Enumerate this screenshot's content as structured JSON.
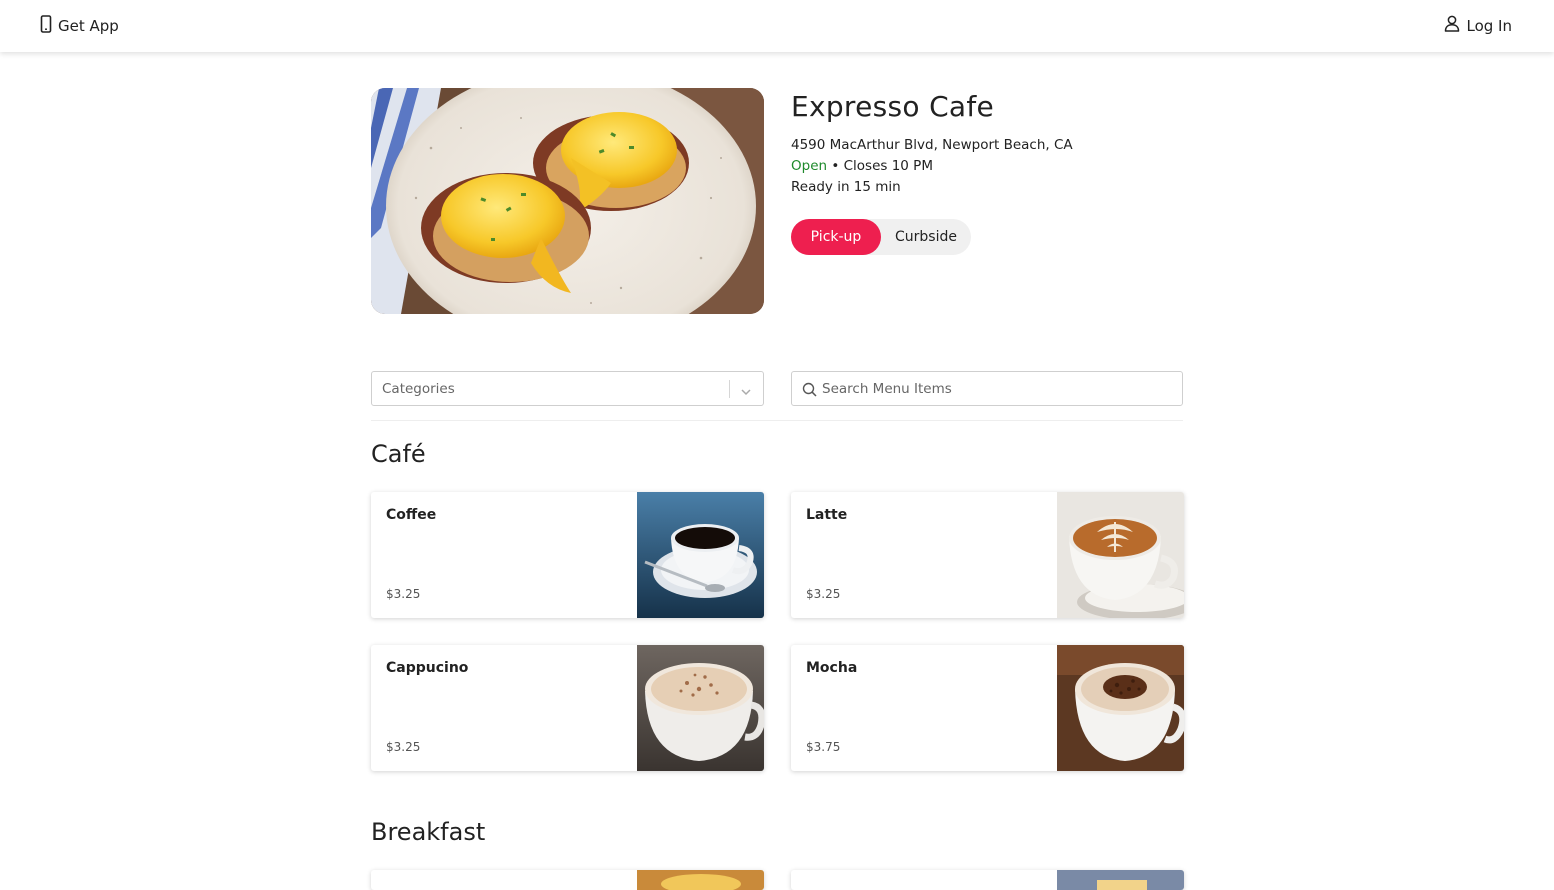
{
  "header": {
    "get_app_label": "Get App",
    "login_label": "Log In"
  },
  "restaurant": {
    "name": "Expresso Cafe",
    "address": "4590 MacArthur Blvd, Newport Beach, CA",
    "status": "Open",
    "closes": " • Closes 10 PM",
    "ready": "Ready in 15 min"
  },
  "order_mode": {
    "options": [
      "Pick-up",
      "Curbside"
    ],
    "selected": "Pick-up",
    "accent": "#ee1f4f"
  },
  "filters": {
    "categories_placeholder": "Categories",
    "search_placeholder": "Search Menu Items"
  },
  "sections": [
    {
      "title": "Café",
      "items": [
        {
          "name": "Coffee",
          "price": "$3.25"
        },
        {
          "name": "Latte",
          "price": "$3.25"
        },
        {
          "name": "Cappucino",
          "price": "$3.25"
        },
        {
          "name": "Mocha",
          "price": "$3.75"
        }
      ]
    },
    {
      "title": "Breakfast"
    }
  ]
}
